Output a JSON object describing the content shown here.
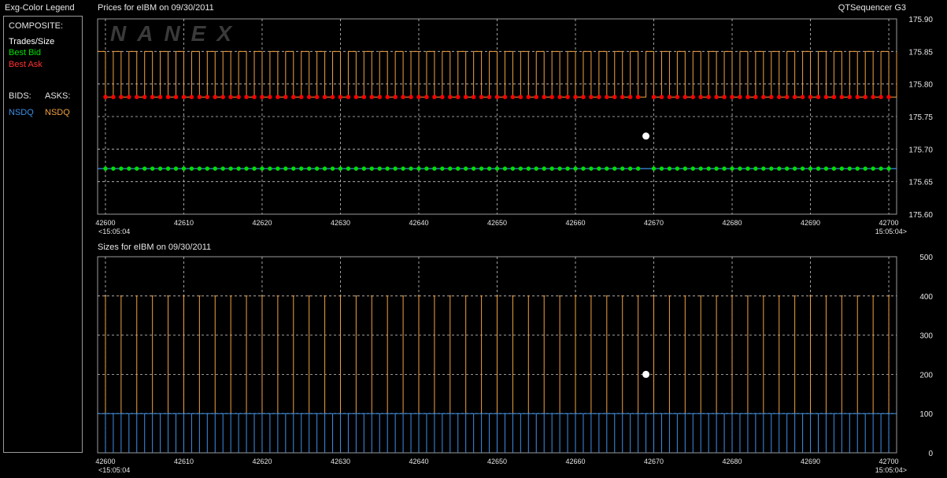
{
  "legend": {
    "title": "Exg-Color Legend",
    "composite_label": "COMPOSITE:",
    "trades_label": "Trades/Size",
    "best_bid_label": "Best Bid",
    "best_ask_label": "Best Ask",
    "bids_label": "BIDS:",
    "asks_label": "ASKS:",
    "bid_exchange": "NSDQ",
    "ask_exchange": "NSDQ"
  },
  "app_title": "QTSequencer G3",
  "watermark": "NANEX",
  "colors": {
    "trade": "#ffffff",
    "best_bid": "#00e000",
    "best_ask": "#ff0000",
    "bid_exchange": "#3d8fe8",
    "ask_exchange": "#f0a040",
    "grid": "#c8c8c8",
    "frame": "#9a9a9a"
  },
  "chart_data": [
    {
      "type": "line",
      "title": "Prices for  eIBM  on  09/30/2011",
      "x_range": [
        42599,
        42701
      ],
      "x_ticks": [
        42600,
        42610,
        42620,
        42630,
        42640,
        42650,
        42660,
        42670,
        42680,
        42690,
        42700
      ],
      "x_start_label": "<15:05:04",
      "x_end_label": "15:05:04>",
      "ylim": [
        175.6,
        175.9
      ],
      "y_ticks": [
        "175.60",
        "175.65",
        "175.70",
        "175.75",
        "175.80",
        "175.85",
        "175.90"
      ],
      "grid": true,
      "trade": {
        "x": 42669,
        "price": 175.72
      },
      "nsdq_ask": {
        "price_low": 175.78,
        "price_high": 175.85,
        "pattern": "alternates every sequence",
        "x_range": [
          42599,
          42701
        ]
      },
      "nsdq_bid": {
        "price": 175.67
      },
      "best_bid": {
        "price": 175.67,
        "x_range": [
          42600,
          42700
        ],
        "step": 1,
        "gap_at": [
          42669
        ]
      },
      "best_ask": {
        "price": 175.78,
        "x_range": [
          42600,
          42700
        ],
        "step": 1,
        "gap_at": [
          42669
        ]
      }
    },
    {
      "type": "bar",
      "title": "Sizes for  eIBM  on  09/30/2011",
      "x_range": [
        42599,
        42701
      ],
      "x_ticks": [
        42600,
        42610,
        42620,
        42630,
        42640,
        42650,
        42660,
        42670,
        42680,
        42690,
        42700
      ],
      "x_start_label": "<15:05:04",
      "x_end_label": "15:05:04>",
      "ylim": [
        0,
        500
      ],
      "y_ticks": [
        "0",
        "100",
        "200",
        "300",
        "400",
        "500"
      ],
      "grid": true,
      "trade_size": {
        "x": 42669,
        "size": 200
      },
      "nsdq_ask_size": {
        "value": 400,
        "x_range": [
          42600,
          42700
        ],
        "step": 2
      },
      "nsdq_bid_size": {
        "value": 100,
        "x_range": [
          42600,
          42700
        ],
        "step": 1
      }
    }
  ]
}
